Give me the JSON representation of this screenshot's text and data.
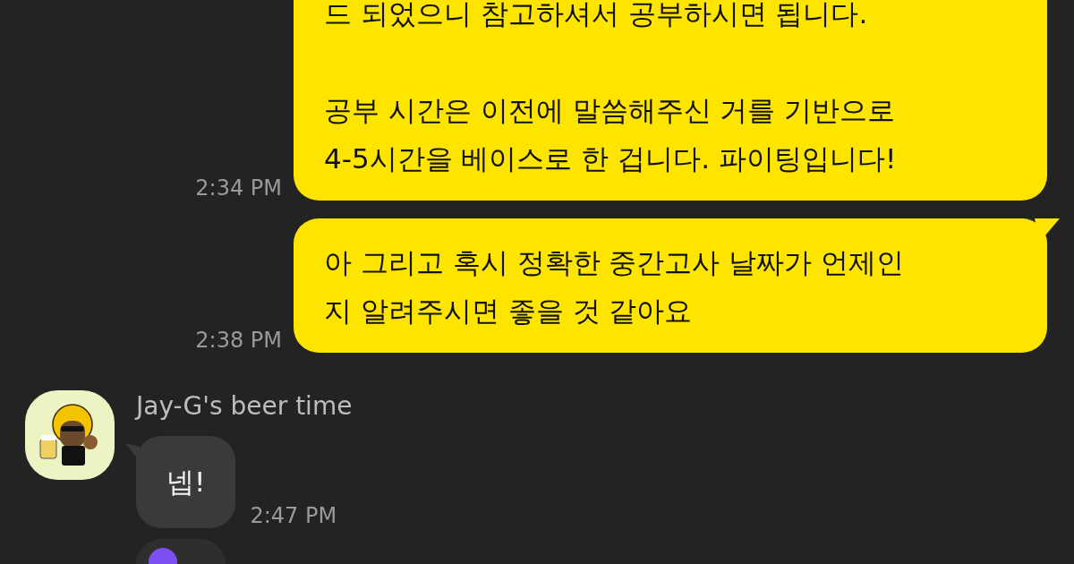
{
  "messages": [
    {
      "kind": "sent",
      "paragraphs": [
        "드 되었으니 참고하셔서 공부하시면 됩니다.",
        "공부 시간은 이전에 말씀해주신 거를 기반으로\n4-5시간을 베이스로 한 겁니다. 파이팅입니다!"
      ],
      "time": "2:34 PM"
    },
    {
      "kind": "sent",
      "paragraphs": [
        "아 그리고 혹시 정확한 중간고사 날짜가 언제인\n지 알려주시면 좋을 것 같아요"
      ],
      "time": "2:38 PM",
      "tail": true
    },
    {
      "kind": "received",
      "sender": "Jay-G's beer time",
      "paragraphs": [
        "넵!"
      ],
      "time": "2:47 PM",
      "tail": true
    },
    {
      "kind": "partial"
    }
  ]
}
